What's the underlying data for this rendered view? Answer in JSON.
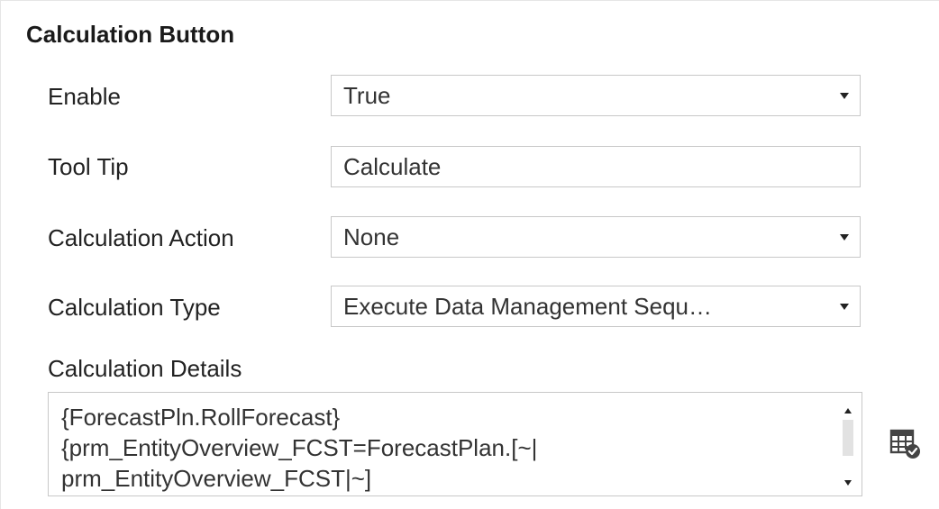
{
  "section": {
    "title": "Calculation Button"
  },
  "properties": {
    "enable": {
      "label": "Enable",
      "value": "True"
    },
    "tool_tip": {
      "label": "Tool Tip",
      "value": "Calculate"
    },
    "calculation_action": {
      "label": "Calculation Action",
      "value": "None"
    },
    "calculation_type": {
      "label": "Calculation Type",
      "value": "Execute Data Management Sequ…"
    }
  },
  "details": {
    "label": "Calculation Details",
    "lines": [
      "{ForecastPln.RollForecast}",
      "{prm_EntityOverview_FCST=ForecastPlan.[~|",
      "prm_EntityOverview_FCST|~]"
    ]
  },
  "icons": {
    "dropdown": "caret-down-icon",
    "scroll_up": "scroll-up-icon",
    "scroll_down": "scroll-down-icon",
    "calc_editor": "table-check-icon"
  }
}
